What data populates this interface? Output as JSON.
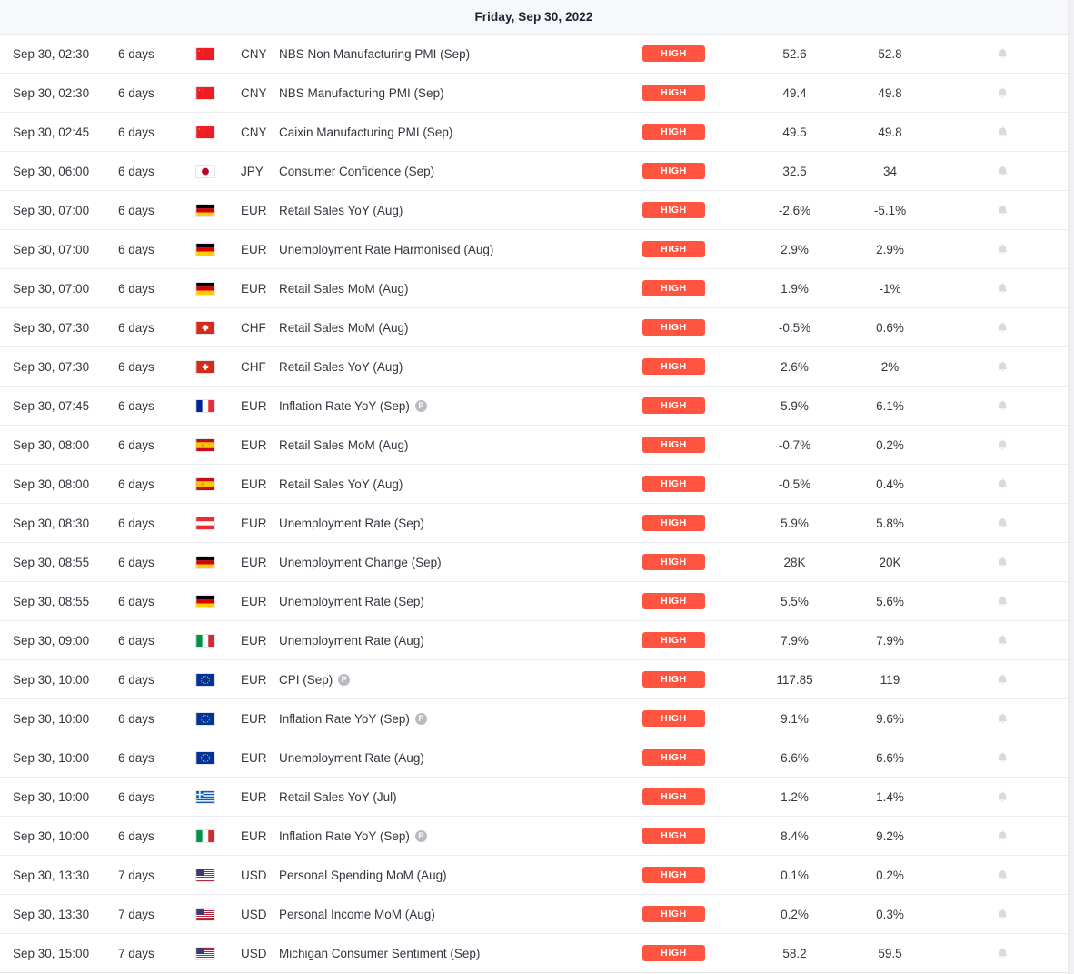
{
  "header": {
    "date_title": "Friday, Sep 30, 2022"
  },
  "icons": {
    "bell": "bell-icon",
    "preliminary": "preliminary-badge-icon",
    "preliminary_letter": "P"
  },
  "colors": {
    "importance_high": "#ff5440",
    "header_background": "#f7f8fc",
    "row_border": "#edeef3",
    "bell": "#d9dadf",
    "text": "#33363f"
  },
  "importance_labels": {
    "high": "HIGH"
  },
  "rows": [
    {
      "time": "Sep 30, 02:30",
      "ago": "6 days",
      "flag": "cn",
      "currency": "CNY",
      "event": "NBS Non Manufacturing PMI (Sep)",
      "preliminary": false,
      "importance": "HIGH",
      "actual": "52.6",
      "forecast": "52.8"
    },
    {
      "time": "Sep 30, 02:30",
      "ago": "6 days",
      "flag": "cn",
      "currency": "CNY",
      "event": "NBS Manufacturing PMI (Sep)",
      "preliminary": false,
      "importance": "HIGH",
      "actual": "49.4",
      "forecast": "49.8"
    },
    {
      "time": "Sep 30, 02:45",
      "ago": "6 days",
      "flag": "cn",
      "currency": "CNY",
      "event": "Caixin Manufacturing PMI (Sep)",
      "preliminary": false,
      "importance": "HIGH",
      "actual": "49.5",
      "forecast": "49.8"
    },
    {
      "time": "Sep 30, 06:00",
      "ago": "6 days",
      "flag": "jp",
      "currency": "JPY",
      "event": "Consumer Confidence (Sep)",
      "preliminary": false,
      "importance": "HIGH",
      "actual": "32.5",
      "forecast": "34"
    },
    {
      "time": "Sep 30, 07:00",
      "ago": "6 days",
      "flag": "de",
      "currency": "EUR",
      "event": "Retail Sales YoY (Aug)",
      "preliminary": false,
      "importance": "HIGH",
      "actual": "-2.6%",
      "forecast": "-5.1%"
    },
    {
      "time": "Sep 30, 07:00",
      "ago": "6 days",
      "flag": "de",
      "currency": "EUR",
      "event": "Unemployment Rate Harmonised (Aug)",
      "preliminary": false,
      "importance": "HIGH",
      "actual": "2.9%",
      "forecast": "2.9%"
    },
    {
      "time": "Sep 30, 07:00",
      "ago": "6 days",
      "flag": "de",
      "currency": "EUR",
      "event": "Retail Sales MoM (Aug)",
      "preliminary": false,
      "importance": "HIGH",
      "actual": "1.9%",
      "forecast": "-1%"
    },
    {
      "time": "Sep 30, 07:30",
      "ago": "6 days",
      "flag": "ch",
      "currency": "CHF",
      "event": "Retail Sales MoM (Aug)",
      "preliminary": false,
      "importance": "HIGH",
      "actual": "-0.5%",
      "forecast": "0.6%"
    },
    {
      "time": "Sep 30, 07:30",
      "ago": "6 days",
      "flag": "ch",
      "currency": "CHF",
      "event": "Retail Sales YoY (Aug)",
      "preliminary": false,
      "importance": "HIGH",
      "actual": "2.6%",
      "forecast": "2%"
    },
    {
      "time": "Sep 30, 07:45",
      "ago": "6 days",
      "flag": "fr",
      "currency": "EUR",
      "event": "Inflation Rate YoY (Sep)",
      "preliminary": true,
      "importance": "HIGH",
      "actual": "5.9%",
      "forecast": "6.1%"
    },
    {
      "time": "Sep 30, 08:00",
      "ago": "6 days",
      "flag": "es",
      "currency": "EUR",
      "event": "Retail Sales MoM (Aug)",
      "preliminary": false,
      "importance": "HIGH",
      "actual": "-0.7%",
      "forecast": "0.2%"
    },
    {
      "time": "Sep 30, 08:00",
      "ago": "6 days",
      "flag": "es",
      "currency": "EUR",
      "event": "Retail Sales YoY (Aug)",
      "preliminary": false,
      "importance": "HIGH",
      "actual": "-0.5%",
      "forecast": "0.4%"
    },
    {
      "time": "Sep 30, 08:30",
      "ago": "6 days",
      "flag": "at",
      "currency": "EUR",
      "event": "Unemployment Rate (Sep)",
      "preliminary": false,
      "importance": "HIGH",
      "actual": "5.9%",
      "forecast": "5.8%"
    },
    {
      "time": "Sep 30, 08:55",
      "ago": "6 days",
      "flag": "de",
      "currency": "EUR",
      "event": "Unemployment Change (Sep)",
      "preliminary": false,
      "importance": "HIGH",
      "actual": "28K",
      "forecast": "20K"
    },
    {
      "time": "Sep 30, 08:55",
      "ago": "6 days",
      "flag": "de",
      "currency": "EUR",
      "event": "Unemployment Rate (Sep)",
      "preliminary": false,
      "importance": "HIGH",
      "actual": "5.5%",
      "forecast": "5.6%"
    },
    {
      "time": "Sep 30, 09:00",
      "ago": "6 days",
      "flag": "it",
      "currency": "EUR",
      "event": "Unemployment Rate (Aug)",
      "preliminary": false,
      "importance": "HIGH",
      "actual": "7.9%",
      "forecast": "7.9%"
    },
    {
      "time": "Sep 30, 10:00",
      "ago": "6 days",
      "flag": "eu",
      "currency": "EUR",
      "event": "CPI (Sep)",
      "preliminary": true,
      "importance": "HIGH",
      "actual": "117.85",
      "forecast": "119"
    },
    {
      "time": "Sep 30, 10:00",
      "ago": "6 days",
      "flag": "eu",
      "currency": "EUR",
      "event": "Inflation Rate YoY (Sep)",
      "preliminary": true,
      "importance": "HIGH",
      "actual": "9.1%",
      "forecast": "9.6%"
    },
    {
      "time": "Sep 30, 10:00",
      "ago": "6 days",
      "flag": "eu",
      "currency": "EUR",
      "event": "Unemployment Rate (Aug)",
      "preliminary": false,
      "importance": "HIGH",
      "actual": "6.6%",
      "forecast": "6.6%"
    },
    {
      "time": "Sep 30, 10:00",
      "ago": "6 days",
      "flag": "gr",
      "currency": "EUR",
      "event": "Retail Sales YoY (Jul)",
      "preliminary": false,
      "importance": "HIGH",
      "actual": "1.2%",
      "forecast": "1.4%"
    },
    {
      "time": "Sep 30, 10:00",
      "ago": "6 days",
      "flag": "it",
      "currency": "EUR",
      "event": "Inflation Rate YoY (Sep)",
      "preliminary": true,
      "importance": "HIGH",
      "actual": "8.4%",
      "forecast": "9.2%"
    },
    {
      "time": "Sep 30, 13:30",
      "ago": "7 days",
      "flag": "us",
      "currency": "USD",
      "event": "Personal Spending MoM (Aug)",
      "preliminary": false,
      "importance": "HIGH",
      "actual": "0.1%",
      "forecast": "0.2%"
    },
    {
      "time": "Sep 30, 13:30",
      "ago": "7 days",
      "flag": "us",
      "currency": "USD",
      "event": "Personal Income MoM (Aug)",
      "preliminary": false,
      "importance": "HIGH",
      "actual": "0.2%",
      "forecast": "0.3%"
    },
    {
      "time": "Sep 30, 15:00",
      "ago": "7 days",
      "flag": "us",
      "currency": "USD",
      "event": "Michigan Consumer Sentiment (Sep)",
      "preliminary": false,
      "importance": "HIGH",
      "actual": "58.2",
      "forecast": "59.5"
    }
  ]
}
